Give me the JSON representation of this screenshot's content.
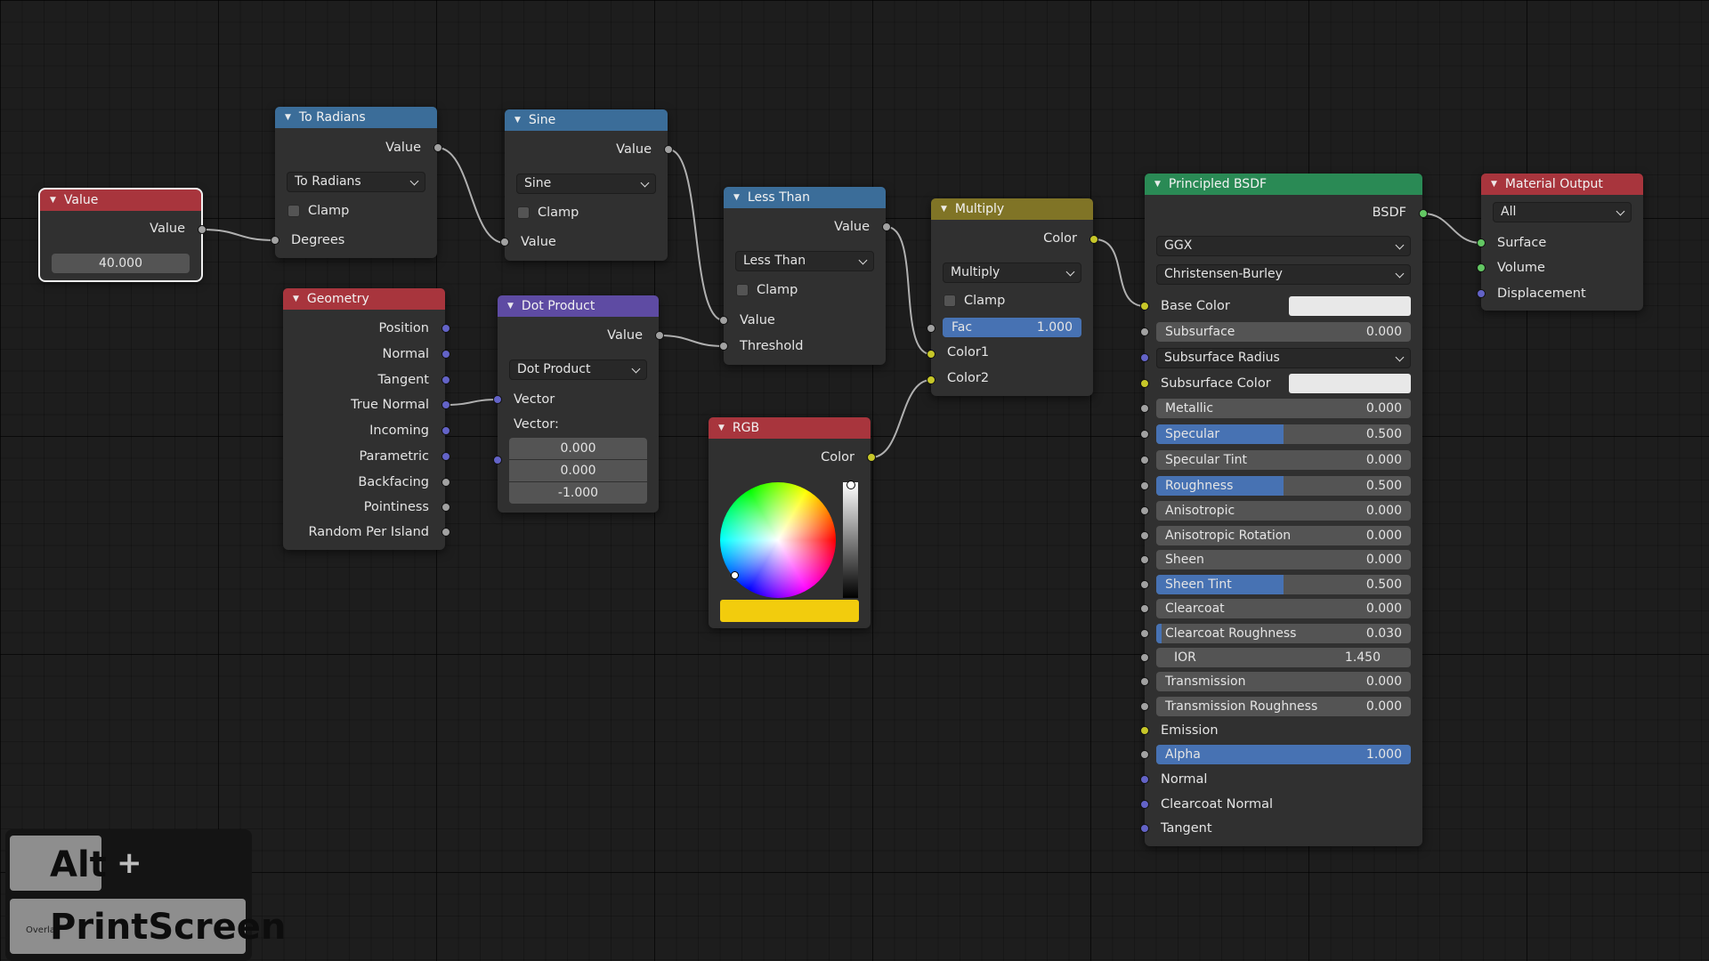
{
  "colors": {
    "header_blue": "#3b6d99",
    "header_red": "#a8353d",
    "header_purple": "#5e4ba3",
    "header_olive": "#807426",
    "header_green": "#2a8a55",
    "socket_value": "#a1a1a1",
    "socket_vector": "#6363c7",
    "socket_color": "#c7c729",
    "socket_shader": "#63c763",
    "slider_fill": "#4772b3",
    "rgb_color": "#f2cc0d"
  },
  "nodes": {
    "value": {
      "title": "Value",
      "output": "Value",
      "field_value": "40.000"
    },
    "to_radians": {
      "title": "To Radians",
      "output": "Value",
      "operation": "To Radians",
      "clamp_label": "Clamp",
      "input": "Degrees"
    },
    "sine": {
      "title": "Sine",
      "output": "Value",
      "operation": "Sine",
      "clamp_label": "Clamp",
      "input": "Value"
    },
    "geometry": {
      "title": "Geometry",
      "outputs": [
        "Position",
        "Normal",
        "Tangent",
        "True Normal",
        "Incoming",
        "Parametric",
        "Backfacing",
        "Pointiness",
        "Random Per Island"
      ]
    },
    "dot_product": {
      "title": "Dot Product",
      "output": "Value",
      "operation": "Dot Product",
      "input": "Vector",
      "vector_label": "Vector:",
      "vector_values": [
        "0.000",
        "0.000",
        "-1.000"
      ]
    },
    "less_than": {
      "title": "Less Than",
      "output": "Value",
      "operation": "Less Than",
      "clamp_label": "Clamp",
      "inputs": [
        "Value",
        "Threshold"
      ]
    },
    "multiply": {
      "title": "Multiply",
      "output": "Color",
      "operation": "Multiply",
      "clamp_label": "Clamp",
      "fac_label": "Fac",
      "fac_value": "1.000",
      "fac_level": 1.0,
      "inputs": [
        "Color1",
        "Color2"
      ]
    },
    "rgb": {
      "title": "RGB",
      "output": "Color",
      "swatch_color": "#f2cc0d"
    },
    "principled": {
      "title": "Principled BSDF",
      "output": "BSDF",
      "distribution": "GGX",
      "subsurface_method": "Christensen-Burley",
      "base_color_label": "Base Color",
      "subsurface_color_label": "Subsurface Color",
      "subsurface_radius_label": "Subsurface Radius",
      "fields": [
        {
          "label": "Subsurface",
          "value": "0.000",
          "level": 0.0
        },
        {
          "label": "Metallic",
          "value": "0.000",
          "level": 0.0
        },
        {
          "label": "Specular",
          "value": "0.500",
          "level": 0.5
        },
        {
          "label": "Specular Tint",
          "value": "0.000",
          "level": 0.0
        },
        {
          "label": "Roughness",
          "value": "0.500",
          "level": 0.5
        },
        {
          "label": "Anisotropic",
          "value": "0.000",
          "level": 0.0
        },
        {
          "label": "Anisotropic Rotation",
          "value": "0.000",
          "level": 0.0
        },
        {
          "label": "Sheen",
          "value": "0.000",
          "level": 0.0
        },
        {
          "label": "Sheen Tint",
          "value": "0.500",
          "level": 0.5
        },
        {
          "label": "Clearcoat",
          "value": "0.000",
          "level": 0.0
        },
        {
          "label": "Clearcoat Roughness",
          "value": "0.030",
          "level": 0.03
        },
        {
          "label": "IOR",
          "value": "1.450"
        },
        {
          "label": "Transmission",
          "value": "0.000",
          "level": 0.0
        },
        {
          "label": "Transmission Roughness",
          "value": "0.000",
          "level": 0.0
        },
        {
          "label": "Alpha",
          "value": "1.000",
          "level": 1.0
        }
      ],
      "emission_label": "Emission",
      "bottom_inputs": [
        "Normal",
        "Clearcoat Normal",
        "Tangent"
      ]
    },
    "material_output": {
      "title": "Material Output",
      "target": "All",
      "inputs": [
        "Surface",
        "Volume",
        "Displacement"
      ]
    }
  },
  "keys": {
    "alt": "Alt",
    "plus": "+",
    "printscreen": "PrintScreen",
    "overlay_small": "Overlay"
  }
}
